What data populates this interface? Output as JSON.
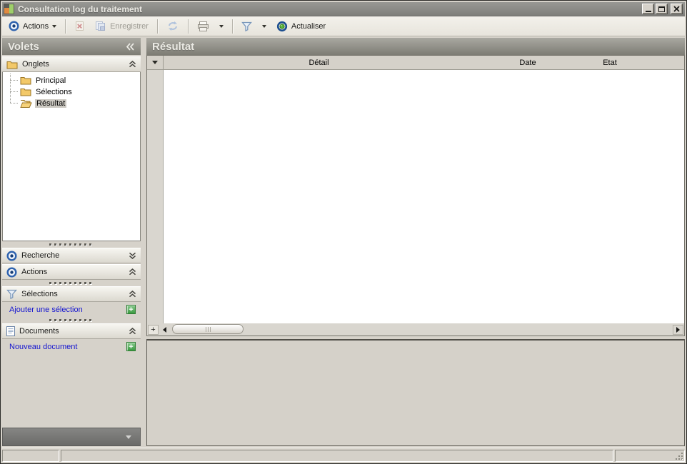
{
  "window": {
    "title": "Consultation log du traitement"
  },
  "toolbar": {
    "actions_label": "Actions",
    "save_label": "Enregistrer",
    "refresh_label": "Actualiser"
  },
  "sidebar": {
    "title": "Volets",
    "sections": {
      "onglets": {
        "label": "Onglets"
      },
      "recherche": {
        "label": "Recherche"
      },
      "actions": {
        "label": "Actions"
      },
      "selections": {
        "label": "Sélections",
        "link_label": "Ajouter une sélection"
      },
      "documents": {
        "label": "Documents",
        "link_label": "Nouveau document"
      }
    },
    "tree": {
      "items": [
        {
          "label": "Principal",
          "selected": false
        },
        {
          "label": "Sélections",
          "selected": false
        },
        {
          "label": "Résultat",
          "selected": true
        }
      ]
    }
  },
  "main": {
    "title": "Résultat",
    "table": {
      "columns": [
        "Détail",
        "Date",
        "Etat"
      ],
      "rows": []
    }
  },
  "icons": {
    "app": "chart-icon",
    "actions": "target-icon",
    "delete": "red-x-document-icon",
    "save": "save-icon",
    "refresh": "sync-arrows-icon",
    "print": "printer-icon",
    "filter": "funnel-icon",
    "actualiser": "refresh-globe-icon",
    "plus": "green-plus-icon"
  },
  "colors": {
    "accent_blue": "#2e62ae",
    "link_blue": "#1515d0",
    "plus_green": "#3b9a41",
    "header_grey": "#8c8b85",
    "panel_bg": "#d6d2ca"
  }
}
